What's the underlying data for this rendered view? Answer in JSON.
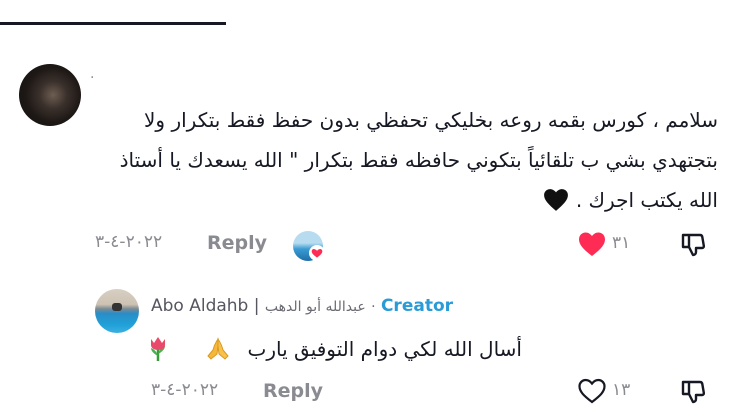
{
  "main_comment": {
    "username": ".",
    "text": "سلامم ، كورس بقمه روعه بخليكي تحفظي بدون حفظ فقط بتكرار ولا بتجتهدي بشي ب تلقائياً بتكوني حافظه فقط بتكرار \" الله يسعدك يا أستاذ الله يكتب اجرك .",
    "emoji": "black-heart",
    "date": "٢٠٢٢-٤-٣",
    "reply_label": "Reply",
    "like_count": "٣١",
    "liked": true,
    "liked_by_creator": true
  },
  "reply_comment": {
    "author_name": "Abo Aldahb",
    "separator": "|",
    "author_arabic": "عبدالله أبو الدهب",
    "dot": "·",
    "badge": "Creator",
    "text": "أسال الله لكي دوام التوفيق يارب",
    "emojis": [
      "folded-hands",
      "tulip"
    ],
    "date": "٢٠٢٢-٤-٣",
    "reply_label": "Reply",
    "like_count": "١٣",
    "liked": false
  },
  "colors": {
    "text": "#161823",
    "muted": "#8a8b91",
    "like_red": "#fe2c55",
    "creator_blue": "#2a9bd6"
  }
}
